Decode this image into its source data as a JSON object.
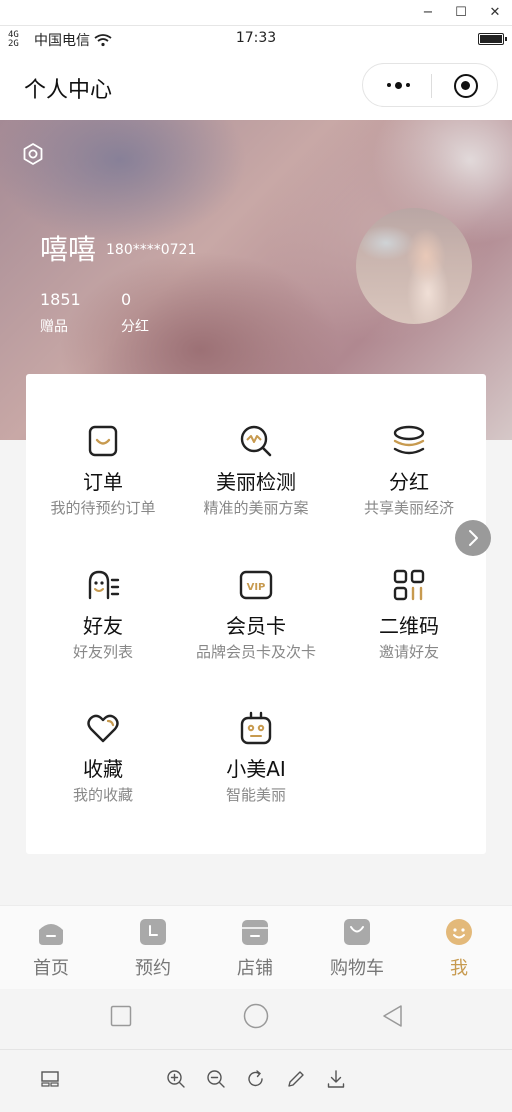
{
  "window": {
    "minimize": "−",
    "maximize": "☐",
    "close": "✕"
  },
  "status_bar": {
    "signal": "4G 2G",
    "carrier": "中国电信",
    "time": "17:33"
  },
  "nav": {
    "title": "个人中心"
  },
  "user": {
    "name": "嘻嘻",
    "phone": "180****0721"
  },
  "stats": [
    {
      "value": "1851",
      "label": "赠品"
    },
    {
      "value": "0",
      "label": "分红"
    }
  ],
  "menu": [
    {
      "title": "订单",
      "subtitle": "我的待预约订单",
      "icon": "order-bag-icon"
    },
    {
      "title": "美丽检测",
      "subtitle": "精准的美丽方案",
      "icon": "beauty-detect-icon"
    },
    {
      "title": "分红",
      "subtitle": "共享美丽经济",
      "icon": "coin-stack-icon"
    },
    {
      "title": "好友",
      "subtitle": "好友列表",
      "icon": "friends-icon"
    },
    {
      "title": "会员卡",
      "subtitle": "品牌会员卡及次卡",
      "icon": "vip-card-icon"
    },
    {
      "title": "二维码",
      "subtitle": "邀请好友",
      "icon": "qrcode-icon"
    },
    {
      "title": "收藏",
      "subtitle": "我的收藏",
      "icon": "heart-icon"
    },
    {
      "title": "小美AI",
      "subtitle": "智能美丽",
      "icon": "robot-icon"
    }
  ],
  "tabs": [
    {
      "label": "首页",
      "icon": "home-icon",
      "active": false
    },
    {
      "label": "预约",
      "icon": "calendar-icon",
      "active": false
    },
    {
      "label": "店铺",
      "icon": "store-icon",
      "active": false
    },
    {
      "label": "购物车",
      "icon": "cart-bag-icon",
      "active": false
    },
    {
      "label": "我",
      "icon": "smile-icon",
      "active": true
    }
  ],
  "colors": {
    "accent": "#c79a4f",
    "icon_dark": "#222222",
    "tab_gray": "#a9a9a9"
  }
}
